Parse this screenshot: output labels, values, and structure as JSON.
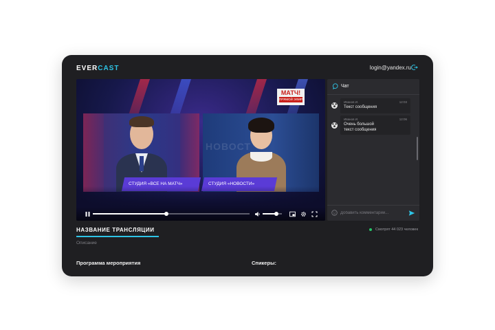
{
  "header": {
    "logo_part1": "EVER",
    "logo_part2": "CAST",
    "user_email": "login@yandex.ru"
  },
  "player": {
    "channel_badge": "МАТЧ!",
    "channel_badge_sub": "ПРЯМОЙ ЭФИР",
    "caption_left": "СТУДИЯ «ВСЕ НА МАТЧ»",
    "caption_right": "СТУДИЯ «НОВОСТИ»",
    "progress": 0.47,
    "volume": 0.7
  },
  "chat": {
    "title": "Чат",
    "messages": [
      {
        "author": "Иванов И.",
        "time": "12:03",
        "text": "Текст сообщения"
      },
      {
        "author": "Иванов И.",
        "time": "12:06",
        "text": "Очень большой текст сообщения"
      }
    ],
    "input_placeholder": "Добавить комментарий..."
  },
  "stream": {
    "title": "НАЗВАНИЕ ТРАНСЛЯЦИИ",
    "description": "Описание",
    "viewers": "Смотрят 44 023 человек"
  },
  "sections": {
    "program": "Программа мероприятия",
    "speakers": "Спикеры:"
  },
  "colors": {
    "accent": "#2ec4e6",
    "caption_bg": "#5a3bd6",
    "online": "#27c46a",
    "send": "#2ec4e6"
  }
}
